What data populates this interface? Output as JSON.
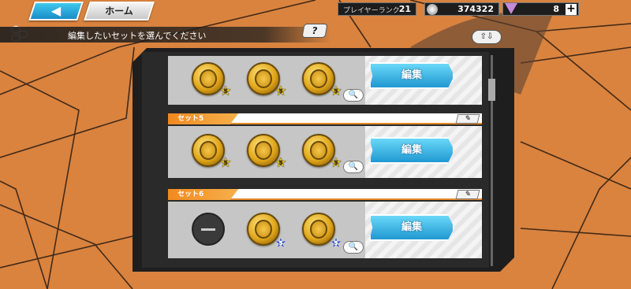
{
  "top_bar": {
    "back_icon": "back-arrow-icon",
    "home_label": "ホーム",
    "rank_label": "プレイヤーランク",
    "rank_value": "21",
    "coin_icon": "coin-icon",
    "coins_value": "374322",
    "gem_icon": "gem-icon",
    "gems_value": "8",
    "plus_label": "+"
  },
  "instruction": "編集したいセットを選んでください",
  "help_label": "?",
  "sort_label": "⇧⇩",
  "sets": [
    {
      "label": "",
      "slots": [
        {
          "kind": "medal",
          "stars": "5",
          "star_color": "gold"
        },
        {
          "kind": "medal",
          "stars": "5",
          "star_color": "gold"
        },
        {
          "kind": "medal",
          "stars": "5",
          "star_color": "gold"
        }
      ],
      "edit_label": "編集"
    },
    {
      "label": "セット5",
      "slots": [
        {
          "kind": "medal",
          "stars": "5",
          "star_color": "gold"
        },
        {
          "kind": "medal",
          "stars": "5",
          "star_color": "gold"
        },
        {
          "kind": "medal",
          "stars": "5",
          "star_color": "gold"
        }
      ],
      "edit_label": "編集"
    },
    {
      "label": "セット6",
      "slots": [
        {
          "kind": "empty"
        },
        {
          "kind": "medal",
          "stars": "5",
          "star_color": "blue"
        },
        {
          "kind": "medal",
          "stars": "5",
          "star_color": "blue"
        }
      ],
      "edit_label": "編集"
    }
  ],
  "colors": {
    "background": "#d9833f",
    "accent_orange": "#f08a20",
    "edit_button": "#1f98d2"
  }
}
